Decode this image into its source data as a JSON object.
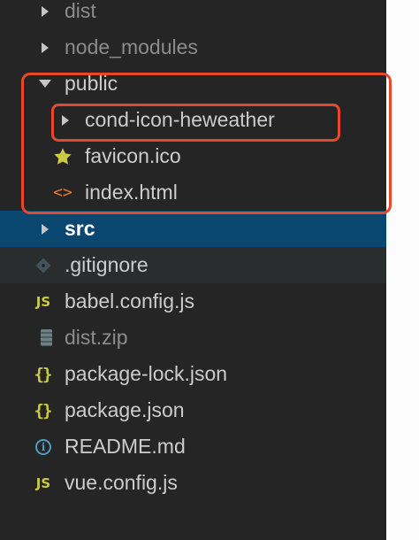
{
  "tree": [
    {
      "label": "dist",
      "icon": "chevron-right-icon",
      "dim": true
    },
    {
      "label": "node_modules",
      "icon": "chevron-right-icon",
      "dim": true
    },
    {
      "label": "public",
      "icon": "chevron-down-icon"
    },
    {
      "label": "cond-icon-heweather",
      "icon": "chevron-right-icon"
    },
    {
      "label": "favicon.ico",
      "icon": "star-icon"
    },
    {
      "label": "index.html",
      "icon": "html-icon",
      "glyph": "<>"
    },
    {
      "label": "src",
      "icon": "chevron-right-icon",
      "selected": true
    },
    {
      "label": ".gitignore",
      "icon": "git-icon"
    },
    {
      "label": "babel.config.js",
      "icon": "javascript-icon",
      "glyph": "JS"
    },
    {
      "label": "dist.zip",
      "icon": "zip-icon",
      "dim": true
    },
    {
      "label": "package-lock.json",
      "icon": "json-icon",
      "glyph": "{}"
    },
    {
      "label": "package.json",
      "icon": "json-icon",
      "glyph": "{}"
    },
    {
      "label": "README.md",
      "icon": "info-icon",
      "glyph": "i"
    },
    {
      "label": "vue.config.js",
      "icon": "javascript-icon",
      "glyph": "JS"
    }
  ],
  "colors": {
    "background": "#252526",
    "selected": "#094771",
    "highlight": "#e8472b",
    "js": "#cbcb41",
    "html": "#e37933",
    "info": "#519aba",
    "star": "#cbcb41"
  }
}
